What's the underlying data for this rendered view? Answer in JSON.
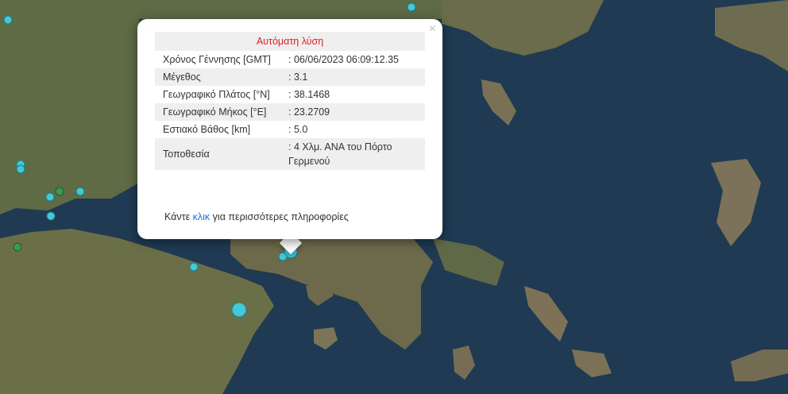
{
  "popup": {
    "title": "Αυτόματη λύση",
    "close_label": "×",
    "rows": [
      {
        "label": "Χρόνος Γέννησης [GMT]",
        "value": ": 06/06/2023 06:09:12.35"
      },
      {
        "label": "Μέγεθος",
        "value": ": 3.1"
      },
      {
        "label": "Γεωγραφικό Πλάτος [°N]",
        "value": ": 38.1468"
      },
      {
        "label": "Γεωγραφικό Μήκος [°E]",
        "value": ": 23.2709"
      },
      {
        "label": "Εστιακό Βάθος [km]",
        "value": ": 5.0"
      },
      {
        "label": "Τοποθεσία",
        "value": ": 4 Χλμ. ΑΝΑ του Πόρτο Γερμενού"
      }
    ],
    "footer_pre": "Κάντε ",
    "footer_link": "κλικ",
    "footer_post": " για περισσότερες πληροφορίες"
  },
  "colors": {
    "sea": "#1f3a52",
    "land": "#5e6b45",
    "marker": "#43c8d6",
    "marker_green": "#3a9a52",
    "title_red": "#e02020"
  },
  "icons": [
    "close-icon",
    "earthquake-marker"
  ]
}
